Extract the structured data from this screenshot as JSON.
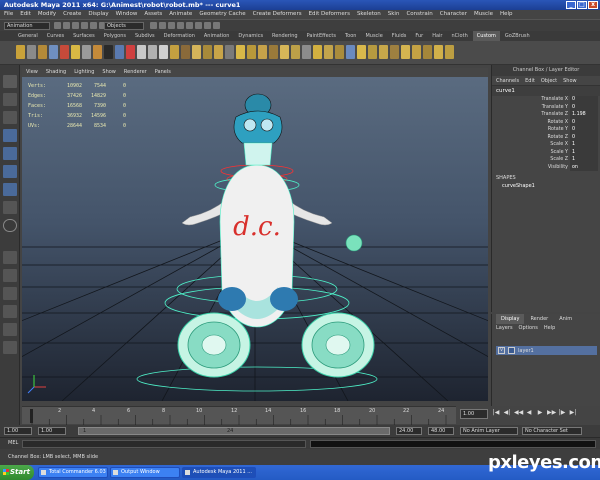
{
  "window": {
    "title": "Autodesk Maya 2011 x64: G:\\Animest\\robot\\robot.mb*   ---   curve1"
  },
  "menubar": [
    "File",
    "Edit",
    "Modify",
    "Create",
    "Display",
    "Window",
    "Assets",
    "Animate",
    "Geometry Cache",
    "Create Deformers",
    "Edit Deformers",
    "Skeleton",
    "Skin",
    "Constrain",
    "Character",
    "Muscle",
    "Help"
  ],
  "statusline": {
    "mode": "Animation",
    "selection_mask": "Objects"
  },
  "shelf": {
    "tabs": [
      "General",
      "Curves",
      "Surfaces",
      "Polygons",
      "Subdivs",
      "Deformation",
      "Animation",
      "Dynamics",
      "Rendering",
      "PaintEffects",
      "Toon",
      "Muscle",
      "Fluids",
      "Fur",
      "Hair",
      "nCloth",
      "Custom",
      "GoZBrush"
    ],
    "active_tab": "Custom"
  },
  "viewport": {
    "menu": [
      "View",
      "Shading",
      "Lighting",
      "Show",
      "Renderer",
      "Panels"
    ],
    "hud": [
      {
        "label": "Verts:",
        "a": "10902",
        "b": "7544",
        "c": "0"
      },
      {
        "label": "Edges:",
        "a": "37426",
        "b": "14829",
        "c": "0"
      },
      {
        "label": "Faces:",
        "a": "16568",
        "b": "7390",
        "c": "0"
      },
      {
        "label": "Tris:",
        "a": "36932",
        "b": "14596",
        "c": "0"
      },
      {
        "label": "UVs:",
        "a": "28644",
        "b": "8534",
        "c": "0"
      }
    ],
    "body_text": "d.c."
  },
  "channel_box": {
    "title": "Channel Box / Layer Editor",
    "menu": [
      "Channels",
      "Edit",
      "Object",
      "Show"
    ],
    "object_name": "curve1",
    "attributes": [
      {
        "name": "Translate X",
        "value": "0"
      },
      {
        "name": "Translate Y",
        "value": "0"
      },
      {
        "name": "Translate Z",
        "value": "1.198"
      },
      {
        "name": "Rotate X",
        "value": "0"
      },
      {
        "name": "Rotate Y",
        "value": "0"
      },
      {
        "name": "Rotate Z",
        "value": "0"
      },
      {
        "name": "Scale X",
        "value": "1"
      },
      {
        "name": "Scale Y",
        "value": "1"
      },
      {
        "name": "Scale Z",
        "value": "1"
      },
      {
        "name": "Visibility",
        "value": "on"
      }
    ],
    "shapes_label": "SHAPES",
    "shape_name": "curveShape1"
  },
  "layer_editor": {
    "tabs": [
      "Display",
      "Render",
      "Anim"
    ],
    "active_tab": "Display",
    "menu": [
      "Layers",
      "Options",
      "Help"
    ],
    "layer": {
      "visible": "V",
      "name": "layer1"
    }
  },
  "timeline": {
    "ticks": [
      "2",
      "4",
      "6",
      "8",
      "10",
      "12",
      "14",
      "16",
      "18",
      "20",
      "22",
      "24"
    ],
    "current_time": "1.00",
    "controls": [
      "|◀",
      "◀|",
      "◀◀",
      "◀",
      "▶",
      "▶▶",
      "|▶",
      "▶|"
    ]
  },
  "range": {
    "start": "1.00",
    "playback_start": "1.00",
    "slider_left": "1",
    "slider_right": "24",
    "playback_end": "24.00",
    "end": "48.00",
    "anim_layer": "No Anim Layer",
    "character_set": "No Character Set"
  },
  "command_line": {
    "label": "MEL"
  },
  "help_line": "Channel Box: LMB select, MMB slide",
  "taskbar": {
    "start": "Start",
    "items": [
      {
        "label": "Total Commander 6.03 - ..."
      },
      {
        "label": "Output Window"
      },
      {
        "label": "Autodesk Maya 2011 ..."
      }
    ]
  },
  "watermark": "pxleyes.com",
  "colors": {
    "viewport_top": "#5a6b80",
    "viewport_bottom": "#1e2430",
    "wire": "#4ef0c8",
    "selection": "#5470a0"
  }
}
